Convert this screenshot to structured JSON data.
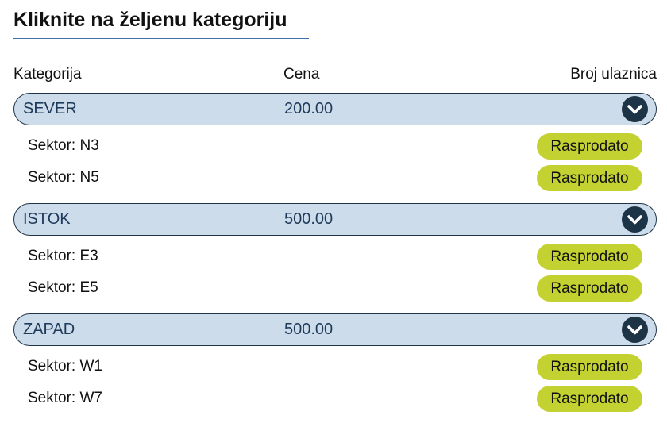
{
  "page": {
    "title": "Kliknite na željenu kategoriju"
  },
  "table_header": {
    "category": "Kategorija",
    "price": "Cena",
    "tickets": "Broj ulaznica"
  },
  "colors": {
    "category_background": "#cddceb",
    "category_border": "#1f3448",
    "chevron_button": "#1d3447",
    "sold_out_button": "#c3d230",
    "title_underline": "#3d6fa8"
  },
  "categories": [
    {
      "name": "SEVER",
      "price": "200.00",
      "expand_icon": "chevron-down-icon",
      "sectors": [
        {
          "label": "Sektor: N3",
          "status": "Rasprodato"
        },
        {
          "label": "Sektor: N5",
          "status": "Rasprodato"
        }
      ]
    },
    {
      "name": "ISTOK",
      "price": "500.00",
      "expand_icon": "chevron-down-icon",
      "sectors": [
        {
          "label": "Sektor: E3",
          "status": "Rasprodato"
        },
        {
          "label": "Sektor: E5",
          "status": "Rasprodato"
        }
      ]
    },
    {
      "name": "ZAPAD",
      "price": "500.00",
      "expand_icon": "chevron-down-icon",
      "sectors": [
        {
          "label": "Sektor: W1",
          "status": "Rasprodato"
        },
        {
          "label": "Sektor: W7",
          "status": "Rasprodato"
        }
      ]
    }
  ]
}
